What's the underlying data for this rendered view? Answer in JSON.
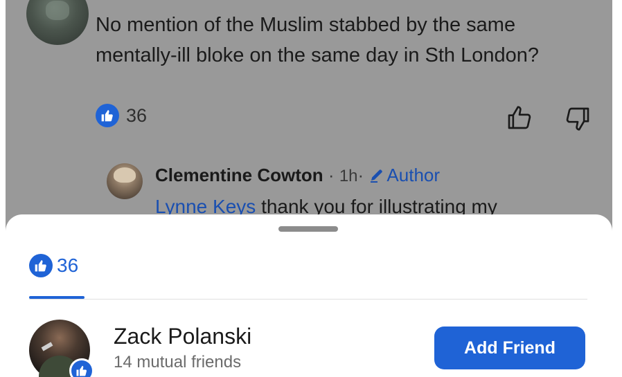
{
  "comment": {
    "text": "No mention of the Muslim stabbed by the same mentally-ill bloke on the same day in Sth London?",
    "like_count": "36"
  },
  "reply": {
    "author_name": "Clementine Cowton",
    "separator": "·",
    "time": "1h",
    "author_badge": "Author",
    "mention": "Lynne Keys",
    "text": "thank you for illustrating my"
  },
  "sheet": {
    "tab_count": "36",
    "user": {
      "name": "Zack Polanski",
      "mutual": "14 mutual friends",
      "button_label": "Add Friend"
    }
  },
  "icons": {
    "like_badge": "thumbs-up-icon",
    "like_button": "thumbs-up-outline-icon",
    "dislike_button": "thumbs-down-outline-icon",
    "author_badge": "pencil-icon"
  },
  "colors": {
    "accent": "#1f63d6",
    "dim_overlay": "#999999",
    "mention": "#1a4fb0"
  }
}
